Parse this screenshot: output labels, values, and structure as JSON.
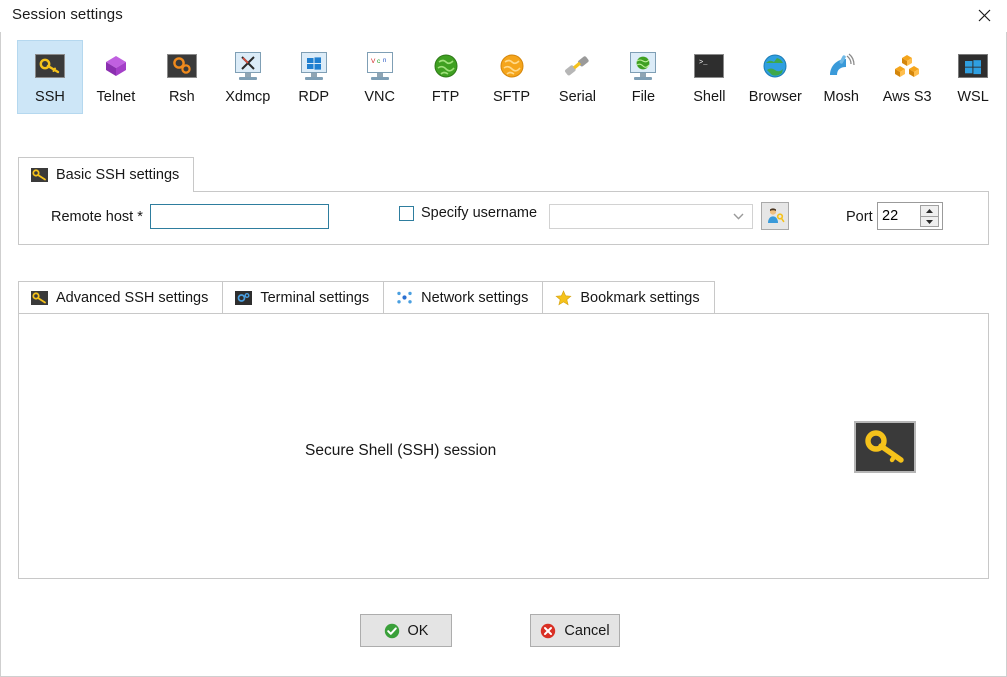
{
  "window": {
    "title": "Session settings",
    "close_label": "close-icon"
  },
  "protocols": {
    "selected": "SSH",
    "items": [
      {
        "label": "SSH",
        "icon": "key-icon"
      },
      {
        "label": "Telnet",
        "icon": "purple-cube-icon"
      },
      {
        "label": "Rsh",
        "icon": "orange-gears-icon"
      },
      {
        "label": "Xdmcp",
        "icon": "x-monitor-icon"
      },
      {
        "label": "RDP",
        "icon": "windows-monitor-icon"
      },
      {
        "label": "VNC",
        "icon": "vnc-monitor-icon"
      },
      {
        "label": "FTP",
        "icon": "green-globe-icon"
      },
      {
        "label": "SFTP",
        "icon": "orange-globe-icon"
      },
      {
        "label": "Serial",
        "icon": "plug-connector-icon"
      },
      {
        "label": "File",
        "icon": "globe-monitor-icon"
      },
      {
        "label": "Shell",
        "icon": "terminal-prompt-icon"
      },
      {
        "label": "Browser",
        "icon": "blue-globe-icon"
      },
      {
        "label": "Mosh",
        "icon": "satellite-dish-icon"
      },
      {
        "label": "Aws S3",
        "icon": "aws-cubes-icon"
      },
      {
        "label": "WSL",
        "icon": "windows-logo-icon"
      }
    ]
  },
  "basic_settings": {
    "tab_label": "Basic SSH settings",
    "tab_icon": "key-icon",
    "remote_host": {
      "label": "Remote host *",
      "value": "",
      "placeholder": ""
    },
    "specify_username": {
      "label": "Specify username",
      "checked": false,
      "value": "",
      "placeholder": ""
    },
    "user_button_icon": "user-key-icon",
    "port": {
      "label": "Port",
      "value": "22"
    }
  },
  "settings_tabs": {
    "selected": "Advanced SSH settings",
    "items": [
      {
        "label": "Advanced SSH settings",
        "icon": "key-icon"
      },
      {
        "label": "Terminal settings",
        "icon": "terminal-gear-icon"
      },
      {
        "label": "Network settings",
        "icon": "network-dots-icon"
      },
      {
        "label": "Bookmark settings",
        "icon": "star-icon"
      }
    ]
  },
  "content": {
    "description": "Secure Shell (SSH) session",
    "big_icon": "key-icon"
  },
  "footer": {
    "ok_label": "OK",
    "ok_icon": "green-check-icon",
    "cancel_label": "Cancel",
    "cancel_icon": "red-x-icon"
  },
  "colors": {
    "selection_blue": "#cde6f7",
    "focus_border": "#2e7d9e",
    "panel_border": "#c8c8c8",
    "button_face": "#e4e4e4",
    "ok_green": "#3aa03a",
    "cancel_red": "#d93025",
    "key_gold": "#f5c21b"
  }
}
